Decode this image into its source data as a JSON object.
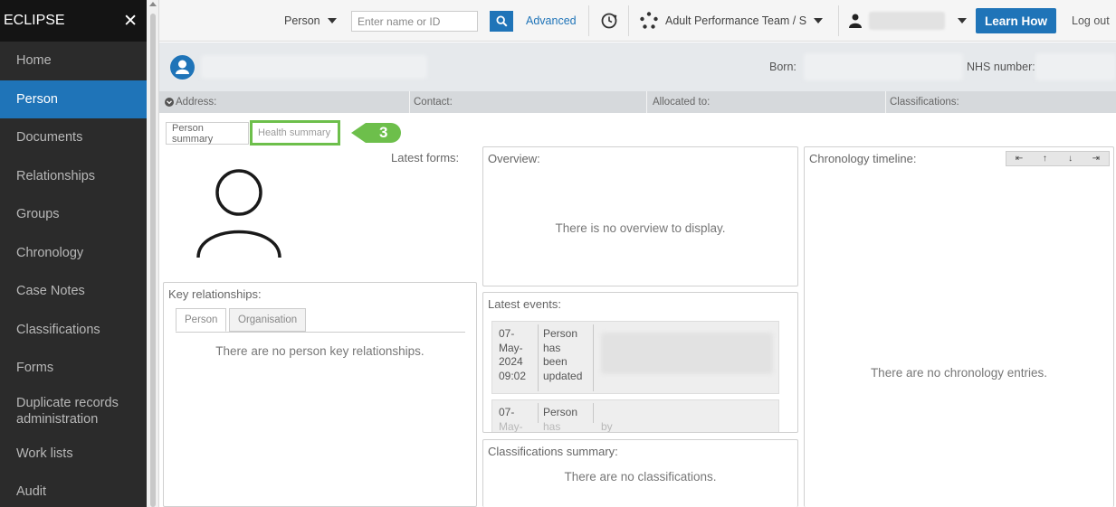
{
  "sidebar": {
    "brand": "ECLIPSE",
    "close": "✕",
    "items": [
      {
        "label": "Home"
      },
      {
        "label": "Person"
      },
      {
        "label": "Documents"
      },
      {
        "label": "Relationships"
      },
      {
        "label": "Groups"
      },
      {
        "label": "Chronology"
      },
      {
        "label": "Case Notes"
      },
      {
        "label": "Classifications"
      },
      {
        "label": "Forms"
      },
      {
        "label": "Duplicate records administration"
      },
      {
        "label": "Work lists"
      },
      {
        "label": "Audit"
      }
    ]
  },
  "topbar": {
    "search_type": "Person",
    "search_placeholder": "Enter name or ID",
    "advanced": "Advanced",
    "team": "Adult Performance Team / S",
    "learn_how": "Learn How",
    "logout": "Log out"
  },
  "person": {
    "born_label": "Born:",
    "nhs_label": "NHS number:"
  },
  "info": {
    "address": "Address:",
    "contact": "Contact:",
    "allocated": "Allocated to:",
    "classifications": "Classifications:"
  },
  "tabs": {
    "person_summary": "Person summary",
    "health_summary": "Health summary",
    "callout": "3"
  },
  "latest_forms": {
    "title": "Latest forms:"
  },
  "overview": {
    "title": "Overview:",
    "empty": "There is no overview to display."
  },
  "key_relationships": {
    "title": "Key relationships:",
    "tab_person": "Person",
    "tab_org": "Organisation",
    "empty": "There are no person key relationships."
  },
  "latest_events": {
    "title": "Latest events:",
    "events": [
      {
        "date": [
          "07-",
          "May-",
          "2024",
          "09:02"
        ],
        "desc": [
          "Person",
          "has",
          "been",
          "updated"
        ]
      },
      {
        "date": [
          "07-",
          "May-"
        ],
        "desc": [
          "Person",
          "has"
        ],
        "extra": "by"
      }
    ]
  },
  "classifications_summary": {
    "title": "Classifications summary:",
    "empty": "There are no classifications."
  },
  "chronology": {
    "title": "Chronology timeline:",
    "empty": "There are no chronology entries.",
    "controls": [
      "⇤",
      "↑",
      "↓",
      "⇥"
    ]
  }
}
